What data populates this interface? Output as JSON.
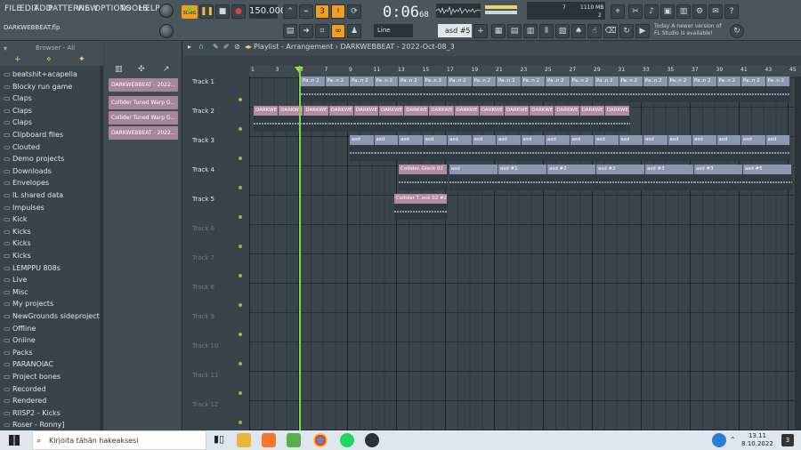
{
  "menu": [
    "FILE",
    "EDIT",
    "ADD",
    "PATTERNS",
    "VIEW",
    "OPTIONS",
    "TOOLS",
    "HELP"
  ],
  "transport": {
    "mode": "SONG",
    "tempo": "150.000",
    "time_main": "0:06",
    "time_sub": "68",
    "snap": "Line",
    "pattern": "asd #5"
  },
  "cpu": {
    "value": "7",
    "memory": "1110 MB",
    "voices": "2"
  },
  "hint": {
    "line1": "Today A newer version of",
    "line2": "FL Studio is available!"
  },
  "filename": "DARKWEBBEAT.flp",
  "browser": {
    "title": "Browser - All",
    "items": [
      "beatshit+acapella",
      "Blocky run game",
      "Claps",
      "Claps",
      "Claps",
      "Clipboard files",
      "Clouted",
      "Demo projects",
      "Downloads",
      "Envelopes",
      "IL shared data",
      "Impulses",
      "Kick",
      "Kicks",
      "Kicks",
      "Kicks",
      "LEMPPU 808s",
      "Live",
      "Misc",
      "My projects",
      "NewGrounds sideproject",
      "Offline",
      "Online",
      "Packs",
      "PARANOIAC",
      "Project bones",
      "Recorded",
      "Rendered",
      "RIISP2 - Kicks",
      "Roser - Ronny]"
    ]
  },
  "picker": [
    "DARKWEBBEAT - 2022...",
    "Collider Tuned Warp G...",
    "Collider Tuned Warp G...",
    "DARKWEBBEAT - 2022..."
  ],
  "playlist": {
    "title": "Playlist - Arrangement",
    "breadcrumb": "DARKWEBBEAT - 2022-Oct-08_3",
    "ruler": [
      "1",
      "3",
      "5",
      "7",
      "9",
      "11",
      "13",
      "15",
      "17",
      "19",
      "21",
      "23",
      "25",
      "27",
      "29",
      "31",
      "33",
      "35",
      "37",
      "39",
      "41",
      "43",
      "45"
    ],
    "tracks": [
      "Track 1",
      "Track 2",
      "Track 3",
      "Track 4",
      "Track 5",
      "Track 6",
      "Track 7",
      "Track 8",
      "Track 9",
      "Track 10",
      "Track 11",
      "Track 12"
    ],
    "clips": {
      "t1": "Pa..n 2",
      "t2": "DARKWE",
      "t2_last": "DARKWE..Oct-08_3",
      "t3": "asd",
      "t4a": "Collider..Glock 02",
      "t4b": "asd",
      "t4c": "asd #1",
      "t4d": "asd #2",
      "t4e": "asd #3",
      "t4f": "asd #5",
      "t5": "Collider T..ock 02 #2"
    }
  },
  "taskbar": {
    "search_placeholder": "Kirjoita tähän hakeaksesi",
    "time": "13.11",
    "date": "8.10.2022",
    "notif": "3"
  },
  "colors": {
    "accent": "#f0a020",
    "playhead": "#7cd840",
    "clip_pink": "#b48aa2",
    "clip_blue": "#8a97ae"
  }
}
